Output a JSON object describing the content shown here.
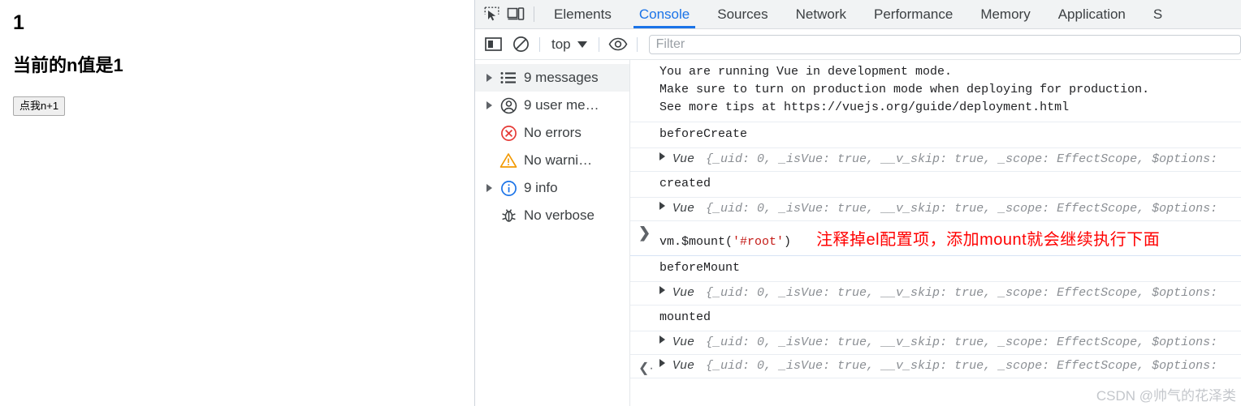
{
  "page": {
    "heading": "1",
    "subheading": "当前的n值是1",
    "button_label": "点我n+1"
  },
  "devtools": {
    "toolbar_icons": [
      {
        "name": "inspect-element-icon",
        "glyph": "inspect"
      },
      {
        "name": "device-toolbar-icon",
        "glyph": "device"
      }
    ],
    "tabs": [
      {
        "label": "Elements",
        "active": false
      },
      {
        "label": "Console",
        "active": true
      },
      {
        "label": "Sources",
        "active": false
      },
      {
        "label": "Network",
        "active": false
      },
      {
        "label": "Performance",
        "active": false
      },
      {
        "label": "Memory",
        "active": false
      },
      {
        "label": "Application",
        "active": false
      },
      {
        "label": "S",
        "active": false
      }
    ],
    "console_toolbar": {
      "sidebar_toggle": "show-console-sidebar-icon",
      "clear_label": "clear-console-icon",
      "context": "top",
      "eye_label": "live-expression-icon",
      "filter_placeholder": "Filter",
      "filter_value": ""
    },
    "sidebar": [
      {
        "label": "9 messages",
        "icon": "list-icon",
        "arrow": true,
        "selected": true
      },
      {
        "label": "9 user me…",
        "icon": "user-icon",
        "arrow": true,
        "selected": false
      },
      {
        "label": "No errors",
        "icon": "error-icon",
        "arrow": false,
        "selected": false
      },
      {
        "label": "No warni…",
        "icon": "warning-icon",
        "arrow": false,
        "selected": false
      },
      {
        "label": "9 info",
        "icon": "info-icon",
        "arrow": true,
        "selected": false
      },
      {
        "label": "No verbose",
        "icon": "bug-icon",
        "arrow": false,
        "selected": false
      }
    ],
    "log": {
      "vue_dev_notice_line1": "You are running Vue in development mode.",
      "vue_dev_notice_line2": "Make sure to turn on production mode when deploying for production.",
      "vue_dev_notice_line3_prefix": "See more tips at ",
      "vue_dev_notice_link": "https://vuejs.org/guide/deployment.html",
      "hook_before_create": "beforeCreate",
      "hook_created": "created",
      "hook_before_mount": "beforeMount",
      "hook_mounted": "mounted",
      "vue_object": {
        "name": "Vue",
        "preview": "{_uid: 0, _isVue: true, __v_skip: true, _scope: EffectScope, $options:",
        "k_uid": "_uid:",
        "v_uid": "0,",
        "k_isvue": "_isVue:",
        "v_isvue": "true,",
        "k_vskip": "__v_skip:",
        "v_vskip": "true,",
        "k_scope": "_scope:",
        "v_scope": "EffectScope,",
        "k_options": "$options:"
      },
      "prompt": {
        "chevron": "❯",
        "code_prefix": "vm.$mount(",
        "code_string": "'#root'",
        "code_suffix": ")",
        "annotation": "注释掉el配置项，添加mount就会继续执行下面"
      },
      "return_chevron": "❮·"
    },
    "watermark": "CSDN @帅气的花泽类"
  },
  "colors": {
    "accent": "#1a73e8",
    "annotation_red": "#ff0000",
    "error_red": "#e53935",
    "warning_orange": "#f29900",
    "info_blue": "#1a73e8",
    "string_red": "#c41a16",
    "value_blue": "#1a56c4"
  }
}
